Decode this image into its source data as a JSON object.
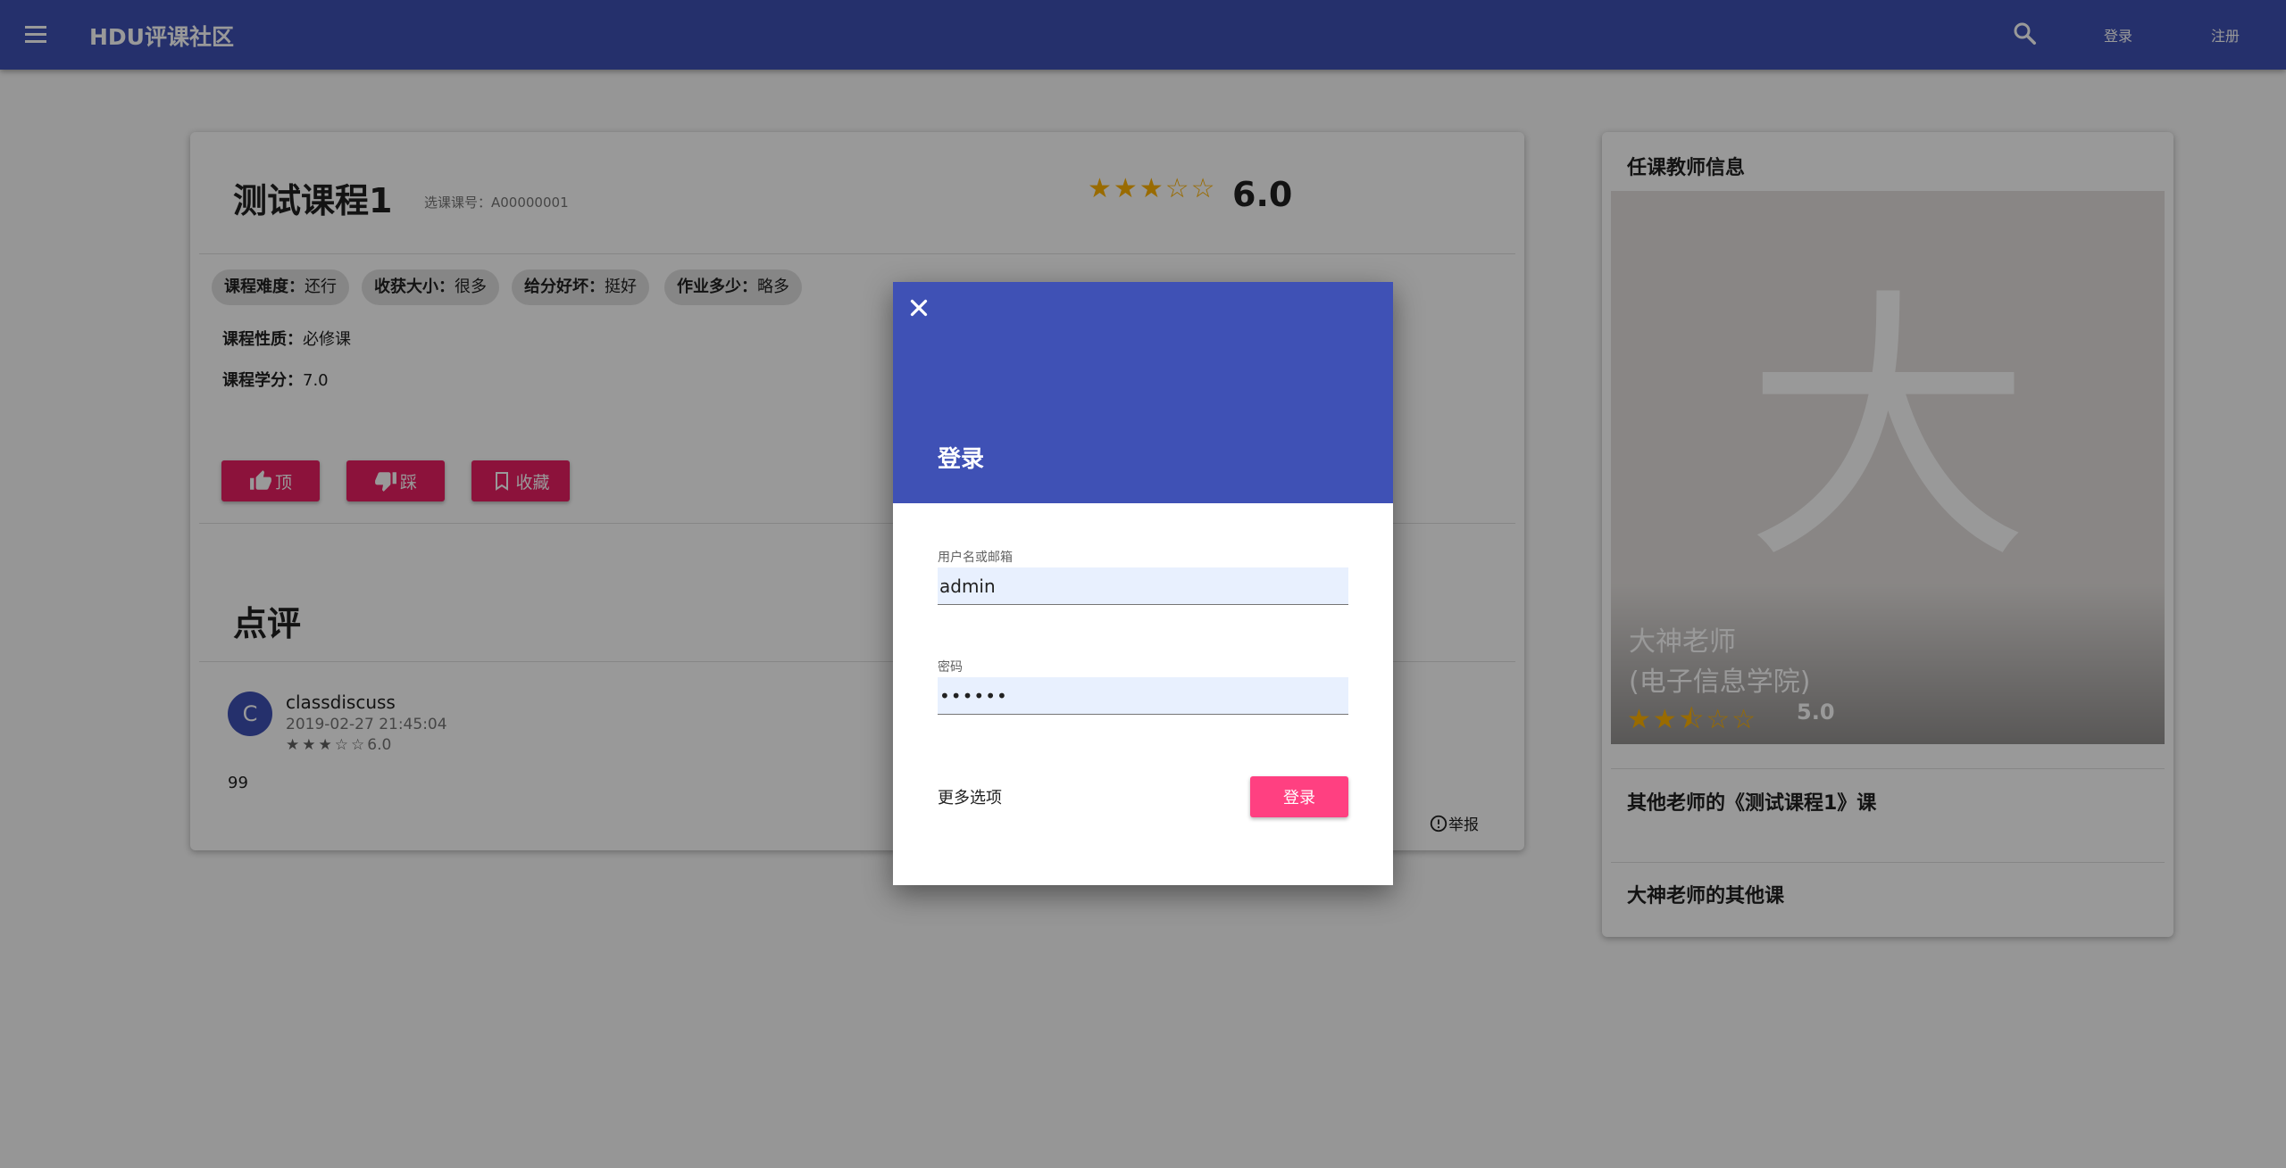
{
  "appbar": {
    "title": "HDU评课社区",
    "login_link": "登录",
    "register_link": "注册"
  },
  "course": {
    "title": "测试课程1",
    "code": "选课课号：A00000001",
    "rating": {
      "stars": 3,
      "max": 5,
      "score": "6.0"
    },
    "tags": [
      {
        "label": "课程难度：",
        "value": "还行"
      },
      {
        "label": "收获大小：",
        "value": "很多"
      },
      {
        "label": "给分好坏：",
        "value": "挺好"
      },
      {
        "label": "作业多少：",
        "value": "略多"
      }
    ],
    "nature_label": "课程性质：",
    "nature_value": "必修课",
    "credit_label": "课程学分：",
    "credit_value": "7.0",
    "buttons": {
      "like": "顶",
      "dislike": "踩",
      "favorite": "收藏"
    }
  },
  "reviews": {
    "title": "点评",
    "items": [
      {
        "avatar_letter": "C",
        "user": "classdiscuss",
        "time": "2019-02-27 21:45:04",
        "stars": 3,
        "score": "6.0",
        "body": "99",
        "report": "举报"
      }
    ]
  },
  "teacher": {
    "heading": "任课教师信息",
    "photo_char": "大",
    "name": "大神老师",
    "department": "(电子信息学院)",
    "stars": 2.5,
    "score": "5.0",
    "other_teachers_link": "其他老师的《测试课程1》课",
    "other_courses_link": "大神老师的其他课"
  },
  "dialog": {
    "title": "登录",
    "username_label": "用户名或邮箱",
    "username_value": "admin",
    "password_label": "密码",
    "password_value": "••••••",
    "more_options": "更多选项",
    "submit": "登录"
  },
  "colors": {
    "primary": "#3f51b5",
    "accent": "#e91e63",
    "star": "#ffb300"
  }
}
